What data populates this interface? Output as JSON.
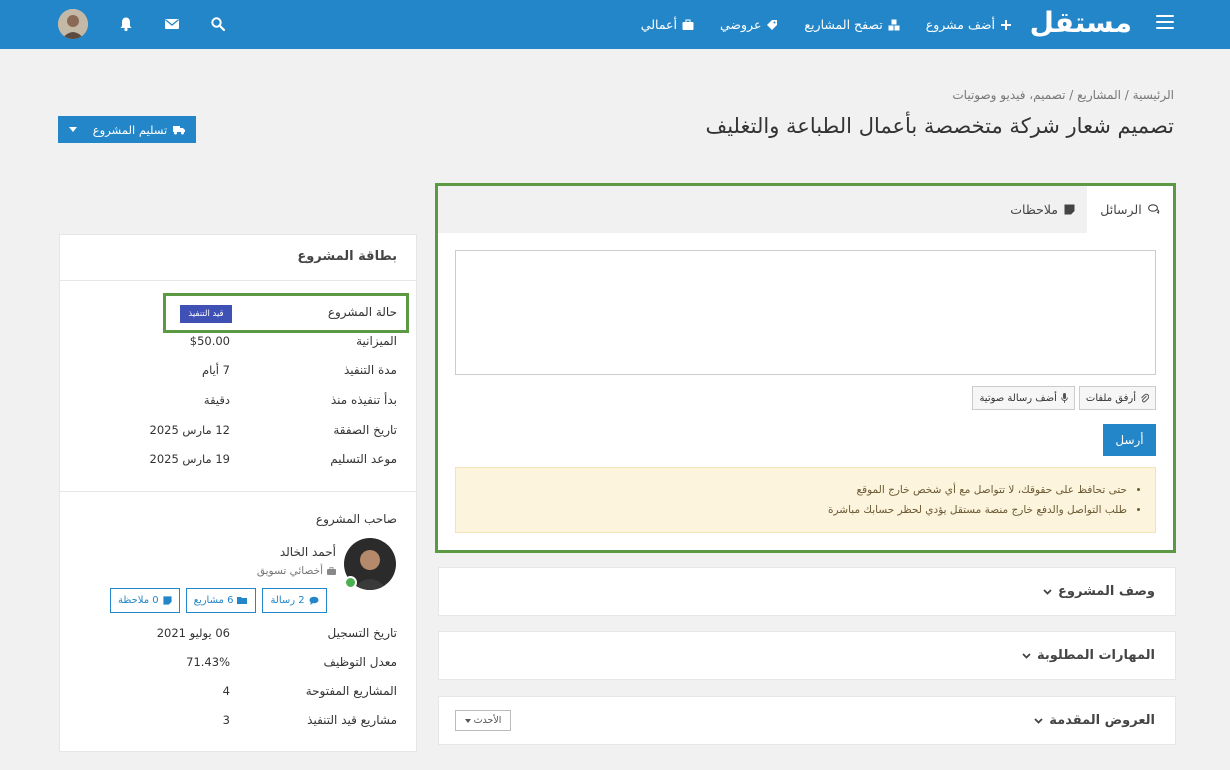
{
  "nav": {
    "logo": "مستقل",
    "links": [
      {
        "label": "أضف مشروع",
        "icon": "plus-icon"
      },
      {
        "label": "تصفح المشاريع",
        "icon": "cubes-icon"
      },
      {
        "label": "عروضي",
        "icon": "tag-icon"
      },
      {
        "label": "أعمالي",
        "icon": "briefcase-icon"
      }
    ]
  },
  "breadcrumb": [
    "الرئيسية",
    "المشاريع",
    "تصميم، فيديو وصوتيات"
  ],
  "page": {
    "title": "تصميم شعار شركة متخصصة بأعمال الطباعة والتغليف",
    "deliver_button": "تسليم المشروع"
  },
  "messages": {
    "tabs": [
      "الرسائل",
      "ملاحظات"
    ],
    "textarea_value": "",
    "attach_files": "أرفق ملفات",
    "add_voice": "أضف رسالة صوتية",
    "send": "أرسل",
    "warnings": [
      "حتى تحافظ على حقوقك، لا تتواصل مع أي شخص خارج الموقع",
      "طلب التواصل والدفع خارج منصة مستقل يؤدي لحظر حسابك مباشرة"
    ]
  },
  "sections": {
    "description": "وصف المشروع",
    "skills": "المهارات المطلوبة",
    "offers": "العروض المقدمة",
    "sort": "الأحدث"
  },
  "card": {
    "title": "بطاقة المشروع",
    "status_label": "حالة المشروع",
    "status_value": "قيد التنفيذ",
    "rows": [
      {
        "label": "الميزانية",
        "value": "$50.00"
      },
      {
        "label": "مدة التنفيذ",
        "value": "7 أيام"
      },
      {
        "label": "بدأ تنفيذه منذ",
        "value": "دقيقة"
      },
      {
        "label": "تاريخ الصفقة",
        "value": "12 مارس 2025"
      },
      {
        "label": "موعد التسليم",
        "value": "19 مارس 2025"
      }
    ],
    "owner_label": "صاحب المشروع",
    "owner": {
      "name": "أحمد الخالد",
      "role": "أخصائي تسويق",
      "stats": [
        "2 رسالة",
        "6 مشاريع",
        "0 ملاحظة"
      ]
    },
    "owner_rows": [
      {
        "label": "تاريخ التسجيل",
        "value": "06 يوليو 2021"
      },
      {
        "label": "معدل التوظيف",
        "value": "71.43%"
      },
      {
        "label": "المشاريع المفتوحة",
        "value": "4"
      },
      {
        "label": "مشاريع قيد التنفيذ",
        "value": "3"
      }
    ]
  },
  "colors": {
    "primary": "#2386c8",
    "highlight": "#5b9a42",
    "status_badge": "#3f51b5",
    "warning_bg": "#fcf4dd"
  }
}
